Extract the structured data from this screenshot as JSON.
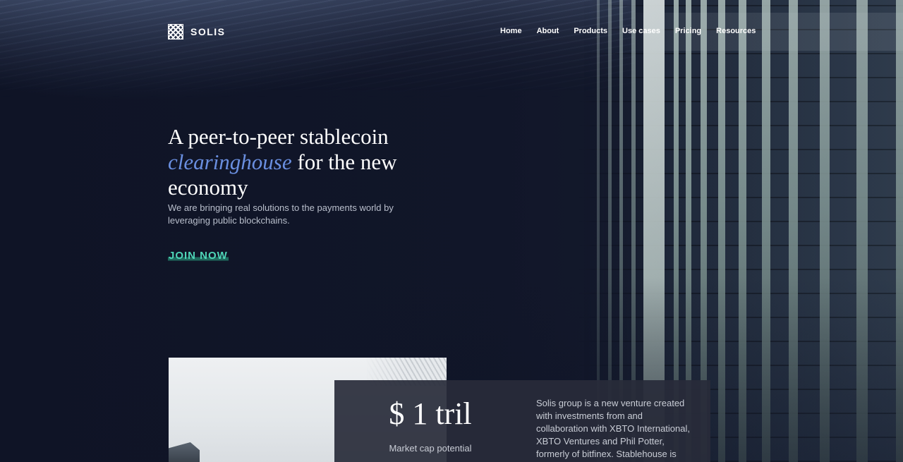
{
  "brand": {
    "name": "SOLIS",
    "logo_icon": "woven-square-icon"
  },
  "nav": {
    "items": [
      {
        "label": "Home"
      },
      {
        "label": "About"
      },
      {
        "label": "Products"
      },
      {
        "label": "Use cases"
      },
      {
        "label": "Pricing"
      },
      {
        "label": "Resources"
      }
    ]
  },
  "hero": {
    "title_line1": "A peer-to-peer stablecoin",
    "title_highlight": "clearinghouse",
    "title_line2_rest": "for the new",
    "title_line3": "economy",
    "subtitle": "We are bringing real solutions to the payments world by leveraging public blockchains.",
    "cta_label": "JOIN NOW"
  },
  "stats": {
    "value": "$ 1 tril",
    "label": "Market cap potential",
    "description": "Solis group is a new venture created with investments from and collaboration with XBTO International, XBTO Ventures and Phil Potter, formerly of bitfinex. Stablehouse is intended to launch a first-"
  },
  "colors": {
    "background": "#0f1426",
    "highlight": "#6a8fe0",
    "cta": "#4fd6b8",
    "card": "#282b3a"
  }
}
